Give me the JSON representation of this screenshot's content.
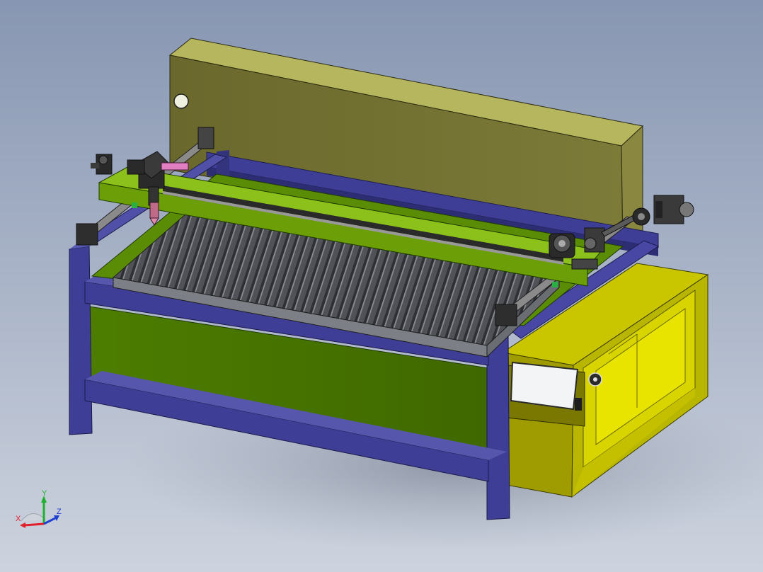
{
  "colors": {
    "background_top": "#8c9cb6",
    "background_bottom": "#c9d0dc",
    "frame_blue": "#3e3e96",
    "frame_blue_dark": "#2b2b70",
    "panel_green": "#4b7a00",
    "panel_green_light": "#7fae16",
    "cabinet_olive": "#6d6b2e",
    "cabinet_olive_top": "#b4b45c",
    "cabinet_yellow": "#c9c600",
    "cabinet_yellow_dark": "#9c9a00",
    "bed_grey": "#5a5c60",
    "screen_white": "#f2f4f6",
    "axis_x": "#e0202a",
    "axis_y": "#20b030",
    "axis_z": "#2040d0"
  },
  "triad": {
    "x_label": "X",
    "y_label": "Y",
    "z_label": "Z"
  }
}
